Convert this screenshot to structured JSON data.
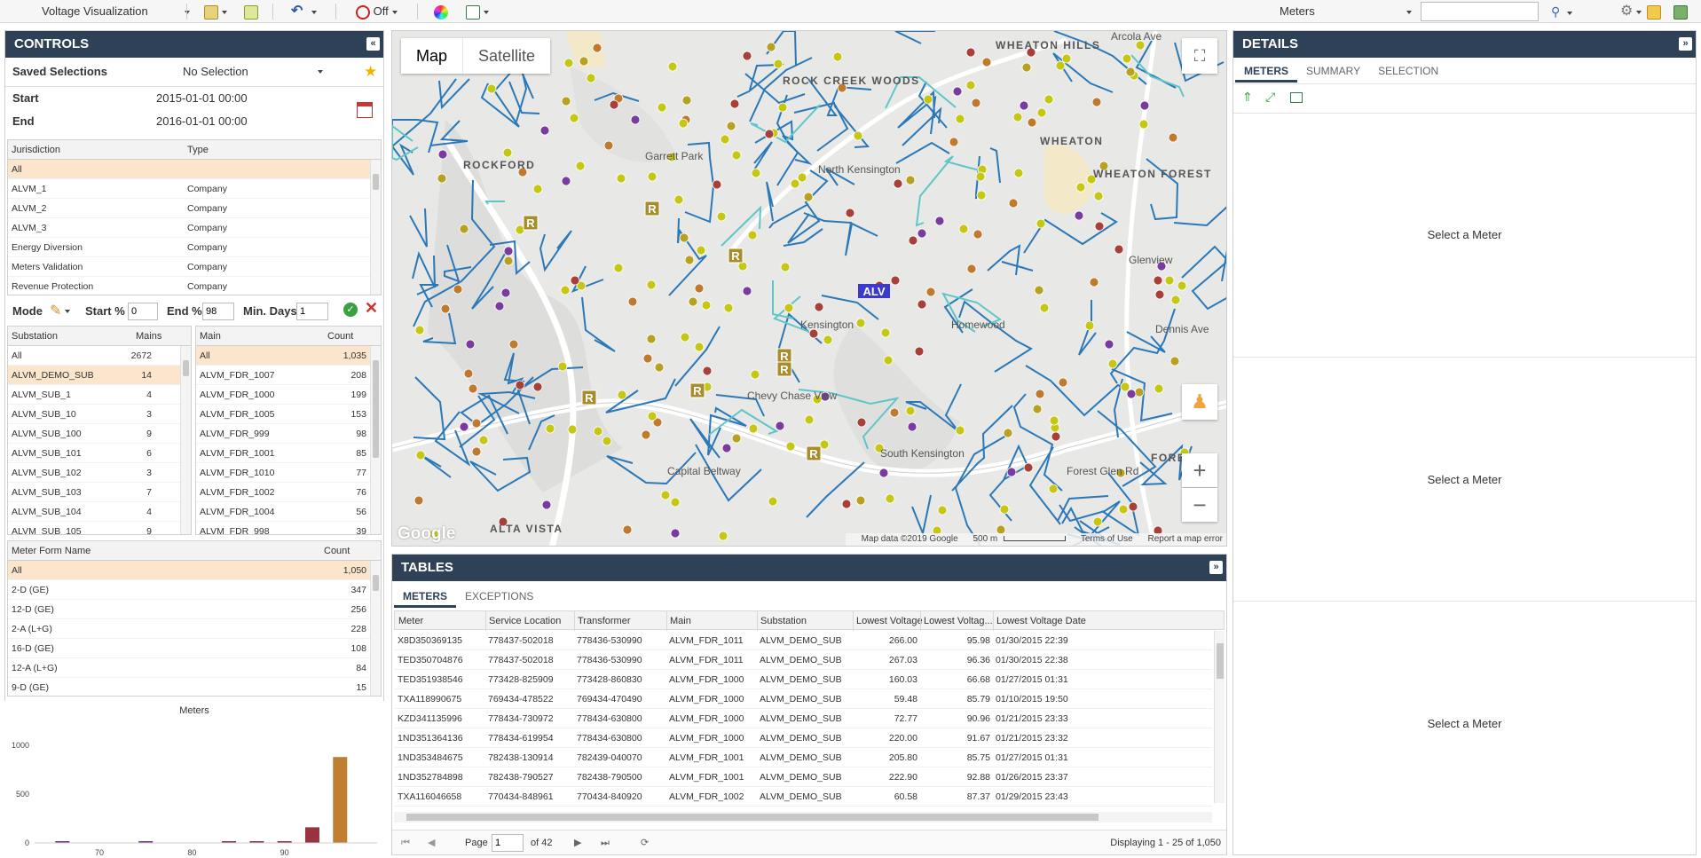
{
  "toolbar": {
    "view_select": "Voltage Visualization",
    "filter_state": "Off",
    "meters_select": "Meters",
    "search_placeholder": ""
  },
  "controls": {
    "title": "CONTROLS",
    "saved_selections_label": "Saved Selections",
    "saved_selections_value": "No Selection",
    "start_label": "Start",
    "start_value": "2015-01-01 00:00",
    "end_label": "End",
    "end_value": "2016-01-01 00:00",
    "jurisdiction_grid": {
      "headers": [
        "Jurisdiction",
        "Type"
      ],
      "rows": [
        {
          "name": "All",
          "type": ""
        },
        {
          "name": "ALVM_1",
          "type": "Company"
        },
        {
          "name": "ALVM_2",
          "type": "Company"
        },
        {
          "name": "ALVM_3",
          "type": "Company"
        },
        {
          "name": "Energy Diversion",
          "type": "Company"
        },
        {
          "name": "Meters Validation",
          "type": "Company"
        },
        {
          "name": "Revenue Protection",
          "type": "Company"
        }
      ]
    },
    "mode_label": "Mode",
    "start_pct_label": "Start %",
    "start_pct_value": "0",
    "end_pct_label": "End %",
    "end_pct_value": "98",
    "min_days_label": "Min. Days",
    "min_days_value": "1",
    "substation_grid": {
      "headers": [
        "Substation",
        "Mains"
      ],
      "rows": [
        {
          "name": "All",
          "count": "2672"
        },
        {
          "name": "ALVM_DEMO_SUB",
          "count": "14"
        },
        {
          "name": "ALVM_SUB_1",
          "count": "4"
        },
        {
          "name": "ALVM_SUB_10",
          "count": "3"
        },
        {
          "name": "ALVM_SUB_100",
          "count": "9"
        },
        {
          "name": "ALVM_SUB_101",
          "count": "6"
        },
        {
          "name": "ALVM_SUB_102",
          "count": "3"
        },
        {
          "name": "ALVM_SUB_103",
          "count": "7"
        },
        {
          "name": "ALVM_SUB_104",
          "count": "4"
        },
        {
          "name": "ALVM_SUB_105",
          "count": "9"
        }
      ]
    },
    "main_grid": {
      "headers": [
        "Main",
        "Count"
      ],
      "rows": [
        {
          "name": "All",
          "count": "1,035"
        },
        {
          "name": "ALVM_FDR_1007",
          "count": "208"
        },
        {
          "name": "ALVM_FDR_1000",
          "count": "199"
        },
        {
          "name": "ALVM_FDR_1005",
          "count": "153"
        },
        {
          "name": "ALVM_FDR_999",
          "count": "98"
        },
        {
          "name": "ALVM_FDR_1001",
          "count": "85"
        },
        {
          "name": "ALVM_FDR_1010",
          "count": "77"
        },
        {
          "name": "ALVM_FDR_1002",
          "count": "76"
        },
        {
          "name": "ALVM_FDR_1004",
          "count": "56"
        },
        {
          "name": "ALVM_FDR_998",
          "count": "39"
        }
      ]
    },
    "meter_form_grid": {
      "headers": [
        "Meter Form Name",
        "Count"
      ],
      "rows": [
        {
          "name": "All",
          "count": "1,050"
        },
        {
          "name": "2-D (GE)",
          "count": "347"
        },
        {
          "name": "12-D (GE)",
          "count": "256"
        },
        {
          "name": "2-A (L+G)",
          "count": "228"
        },
        {
          "name": "16-D (GE)",
          "count": "108"
        },
        {
          "name": "12-A (L+G)",
          "count": "84"
        },
        {
          "name": "9-D (GE)",
          "count": "15"
        }
      ]
    }
  },
  "chart_data": {
    "type": "bar",
    "title": "Meters",
    "xlabel": "",
    "ylabel": "",
    "x_ticks": [
      70,
      80,
      90
    ],
    "y_ticks": [
      0,
      500,
      1000
    ],
    "xlim": [
      63,
      100
    ],
    "ylim": [
      0,
      1000
    ],
    "bars": [
      {
        "x": 66,
        "value": 5,
        "color": "#6b3e7a"
      },
      {
        "x": 75,
        "value": 5,
        "color": "#6b3e7a"
      },
      {
        "x": 84,
        "value": 5,
        "color": "#7a3e6a"
      },
      {
        "x": 87,
        "value": 8,
        "color": "#7a3e6a"
      },
      {
        "x": 90,
        "value": 12,
        "color": "#8a3a55"
      },
      {
        "x": 93,
        "value": 160,
        "color": "#9a3340"
      },
      {
        "x": 96,
        "value": 880,
        "color": "#c07f30"
      }
    ]
  },
  "map": {
    "tab_map": "Map",
    "tab_satellite": "Satellite",
    "labels": [
      {
        "text": "WHEATON HILLS"
      },
      {
        "text": "ROCK CREEK WOODS"
      },
      {
        "text": "WHEATON"
      },
      {
        "text": "WHEATON FOREST"
      },
      {
        "text": "Garrett Park"
      },
      {
        "text": "North Kensington"
      },
      {
        "text": "ROCKFORD"
      },
      {
        "text": "Kensington"
      },
      {
        "text": "Homewood"
      },
      {
        "text": "Glenview"
      },
      {
        "text": "Chevy Chase View"
      },
      {
        "text": "South Kensington"
      },
      {
        "text": "FOREST"
      },
      {
        "text": "Arcola Ave"
      },
      {
        "text": "Dennis Ave"
      },
      {
        "text": "Forest Glen Rd"
      },
      {
        "text": "Capital Beltway"
      },
      {
        "text": "ALTA VISTA"
      }
    ],
    "footer_data": "Map data ©2019 Google",
    "footer_scale": "500 m",
    "footer_terms": "Terms of Use",
    "footer_report": "Report a map error",
    "google": "Google",
    "alv_marker": "ALV",
    "r_marker": "R"
  },
  "tables": {
    "title": "TABLES",
    "tabs": [
      "METERS",
      "EXCEPTIONS"
    ],
    "headers": [
      "Meter",
      "Service Location",
      "Transformer",
      "Main",
      "Substation",
      "Lowest Voltage",
      "Lowest Voltag...",
      "Lowest Voltage Date"
    ],
    "rows": [
      [
        "X8D350369135",
        "778437-502018",
        "778436-530990",
        "ALVM_FDR_1011",
        "ALVM_DEMO_SUB",
        "266.00",
        "95.98",
        "01/30/2015 22:39"
      ],
      [
        "TED350704876",
        "778437-502018",
        "778436-530990",
        "ALVM_FDR_1011",
        "ALVM_DEMO_SUB",
        "267.03",
        "96.36",
        "01/30/2015 22:38"
      ],
      [
        "TED351938546",
        "773428-825909",
        "773428-860830",
        "ALVM_FDR_1000",
        "ALVM_DEMO_SUB",
        "160.03",
        "66.68",
        "01/27/2015 01:31"
      ],
      [
        "TXA118990675",
        "769434-478522",
        "769434-470490",
        "ALVM_FDR_1000",
        "ALVM_DEMO_SUB",
        "59.48",
        "85.79",
        "01/10/2015 19:50"
      ],
      [
        "KZD341135996",
        "778434-730972",
        "778434-630800",
        "ALVM_FDR_1000",
        "ALVM_DEMO_SUB",
        "72.77",
        "90.96",
        "01/21/2015 23:33"
      ],
      [
        "1ND351364136",
        "778434-619954",
        "778434-630800",
        "ALVM_FDR_1000",
        "ALVM_DEMO_SUB",
        "220.00",
        "91.67",
        "01/21/2015 23:32"
      ],
      [
        "1ND353484675",
        "782438-130914",
        "782439-040070",
        "ALVM_FDR_1001",
        "ALVM_DEMO_SUB",
        "205.80",
        "85.75",
        "01/27/2015 01:31"
      ],
      [
        "1ND352784898",
        "782438-790527",
        "782438-790500",
        "ALVM_FDR_1001",
        "ALVM_DEMO_SUB",
        "222.90",
        "92.88",
        "01/26/2015 23:37"
      ],
      [
        "TXA116046658",
        "770434-848961",
        "770434-840920",
        "ALVM_FDR_1002",
        "ALVM_DEMO_SUB",
        "60.58",
        "87.37",
        "01/29/2015 23:43"
      ]
    ],
    "page_label": "Page",
    "page_value": "1",
    "page_of": "of 42",
    "displaying": "Displaying 1 - 25 of 1,050"
  },
  "details": {
    "title": "DETAILS",
    "tabs": [
      "METERS",
      "SUMMARY",
      "SELECTION"
    ],
    "placeholder": "Select a Meter"
  }
}
